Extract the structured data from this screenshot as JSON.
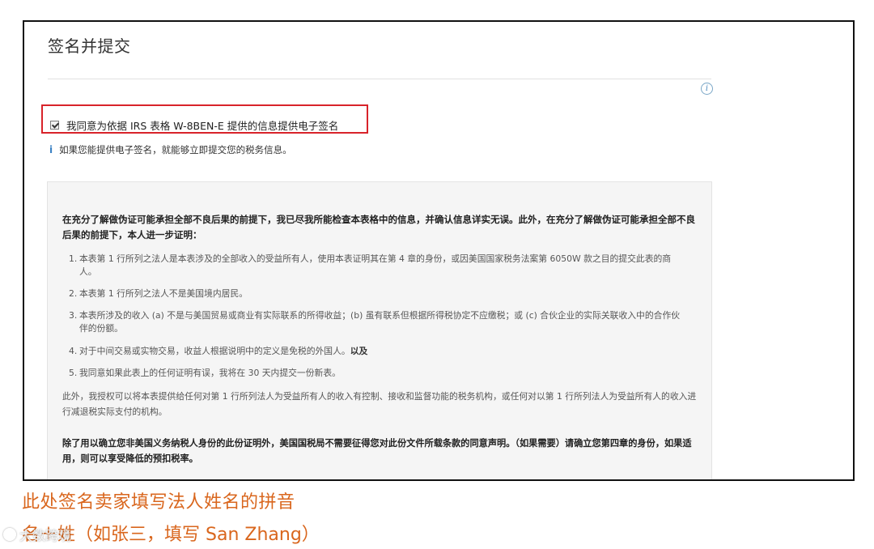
{
  "section": {
    "title": "签名并提交"
  },
  "consent": {
    "label": "我同意为依据 IRS 表格 W-8BEN-E 提供的信息提供电子签名",
    "checked": true,
    "highlight_color": "#d8232a"
  },
  "hint": {
    "icon": "i",
    "text": "如果您能提供电子签名，就能够立即提交您的税务信息。"
  },
  "info_icon": "i",
  "certification": {
    "intro": "在充分了解做伪证可能承担全部不良后果的前提下，我已尽我所能检查本表格中的信息，并确认信息详实无误。此外，在充分了解做伪证可能承担全部不良后果的前提下，本人进一步证明：",
    "items": [
      {
        "num": "1.",
        "text": "本表第 1 行所列之法人是本表涉及的全部收入的受益所有人，使用本表证明其在第 4 章的身份，或因美国国家税务法案第 6050W 款之目的提交此表的商人。"
      },
      {
        "num": "2.",
        "text": "本表第 1 行所列之法人不是美国境内居民。"
      },
      {
        "num": "3.",
        "text": "本表所涉及的收入 (a) 不是与美国贸易或商业有实际联系的所得收益；(b) 虽有联系但根据所得税协定不应缴税；或 (c) 合伙企业的实际关联收入中的合作伙伴的份额。"
      },
      {
        "num": "4.",
        "text": "对于中间交易或实物交易，收益人根据说明中的定义是免税的外国人。",
        "bold_tail": "以及"
      },
      {
        "num": "5.",
        "text": "我同意如果此表上的任何证明有误，我将在 30 天内提交一份新表。"
      }
    ],
    "authorization": "此外，我授权可以将本表提供给任何对第 1 行所列法人为受益所有人的收入有控制、接收和监督功能的税务机构，或任何对以第 1 行所列法人为受益所有人的收入进行减退税实际支付的机构。",
    "irs_note": "除了用以确立您非美国义务纳税人身份的此份证明外，美国国税局不需要征得您对此份文件所载条款的同意声明。（如果需要）请确立您第四章的身份，如果适用，则可以享受降低的预扣税率。"
  },
  "annotation": {
    "line1": "此处签名卖家填写法人姓名的拼音",
    "line2": "名＋姓（如张三，填写 San Zhang）",
    "color": "#d9661d"
  },
  "watermark": {
    "text": "大数跨境"
  }
}
